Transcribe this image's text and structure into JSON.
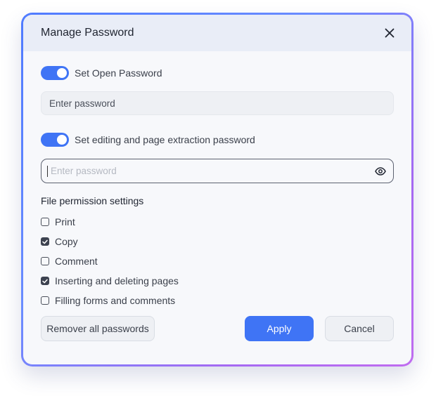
{
  "dialog": {
    "title": "Manage Password"
  },
  "open_password": {
    "enabled": true,
    "label": "Set Open Password",
    "value": "Enter password"
  },
  "edit_password": {
    "enabled": true,
    "label": "Set editing and page extraction password",
    "placeholder": "Enter password"
  },
  "permissions": {
    "title": "File permission settings",
    "items": [
      {
        "label": "Print",
        "checked": false
      },
      {
        "label": "Copy",
        "checked": true
      },
      {
        "label": "Comment",
        "checked": false
      },
      {
        "label": "Inserting and deleting pages",
        "checked": true
      },
      {
        "label": "Filling forms and comments",
        "checked": false
      }
    ]
  },
  "buttons": {
    "remove_label": "Remover all passwords",
    "apply_label": "Apply",
    "cancel_label": "Cancel"
  },
  "colors": {
    "accent": "#3f74f5",
    "frame_gradient_start": "#4f7bff",
    "frame_gradient_end": "#c06cf0"
  }
}
